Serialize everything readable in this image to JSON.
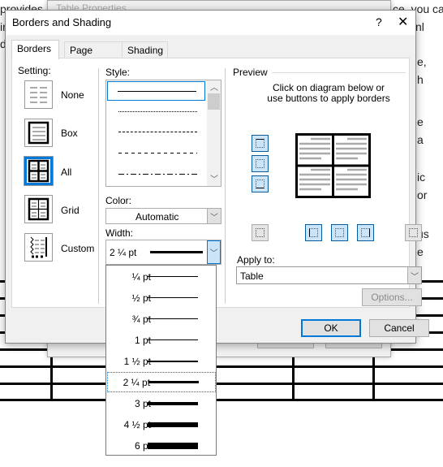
{
  "background_document": {
    "fragments_left": [
      "provides",
      "in",
      "de",
      "k",
      "ox",
      "de",
      "e,",
      "y",
      "in",
      "y",
      "c",
      "ng",
      "xt",
      "f"
    ],
    "fragments_right": [
      "ce, you can",
      "nl",
      "e,",
      "h",
      "e",
      "a",
      "ic",
      "or",
      "us",
      "e"
    ]
  },
  "background_dialog": {
    "title": "Table Properties",
    "help": "?",
    "close": "✕"
  },
  "dialog": {
    "title": "Borders and Shading",
    "help_label": "?",
    "close_label": "✕",
    "tabs": [
      {
        "label": "Borders",
        "active": true
      },
      {
        "label": "Page Border",
        "active": false
      },
      {
        "label": "Shading",
        "active": false
      }
    ],
    "setting": {
      "label": "Setting:",
      "options": [
        {
          "label": "None",
          "icon": "setting-none-icon",
          "selected": false
        },
        {
          "label": "Box",
          "icon": "setting-box-icon",
          "selected": false
        },
        {
          "label": "All",
          "icon": "setting-all-icon",
          "selected": true
        },
        {
          "label": "Grid",
          "icon": "setting-grid-icon",
          "selected": false
        },
        {
          "label": "Custom",
          "icon": "setting-custom-icon",
          "selected": false
        }
      ]
    },
    "style": {
      "label": "Style:",
      "options": [
        "solid",
        "dotted",
        "dashed-small",
        "dashed",
        "dash-dot"
      ],
      "selected": "solid"
    },
    "color": {
      "label": "Color:",
      "value": "Automatic"
    },
    "width": {
      "label": "Width:",
      "value": "2 ¼ pt",
      "options": [
        "¼ pt",
        "½ pt",
        "¾ pt",
        "1 pt",
        "1 ½ pt",
        "2 ¼ pt",
        "3 pt",
        "4 ½ pt",
        "6 pt"
      ],
      "selected_index": 5
    },
    "preview": {
      "label": "Preview",
      "instruction_line1": "Click on diagram below or",
      "instruction_line2": "use buttons to apply borders"
    },
    "apply_to": {
      "label": "Apply to:",
      "value": "Table"
    },
    "options_button": "Options...",
    "ok_button": "OK",
    "cancel_button": "Cancel",
    "colors": {
      "accent": "#0078d7",
      "toggle_on": "#cce4f7"
    }
  }
}
